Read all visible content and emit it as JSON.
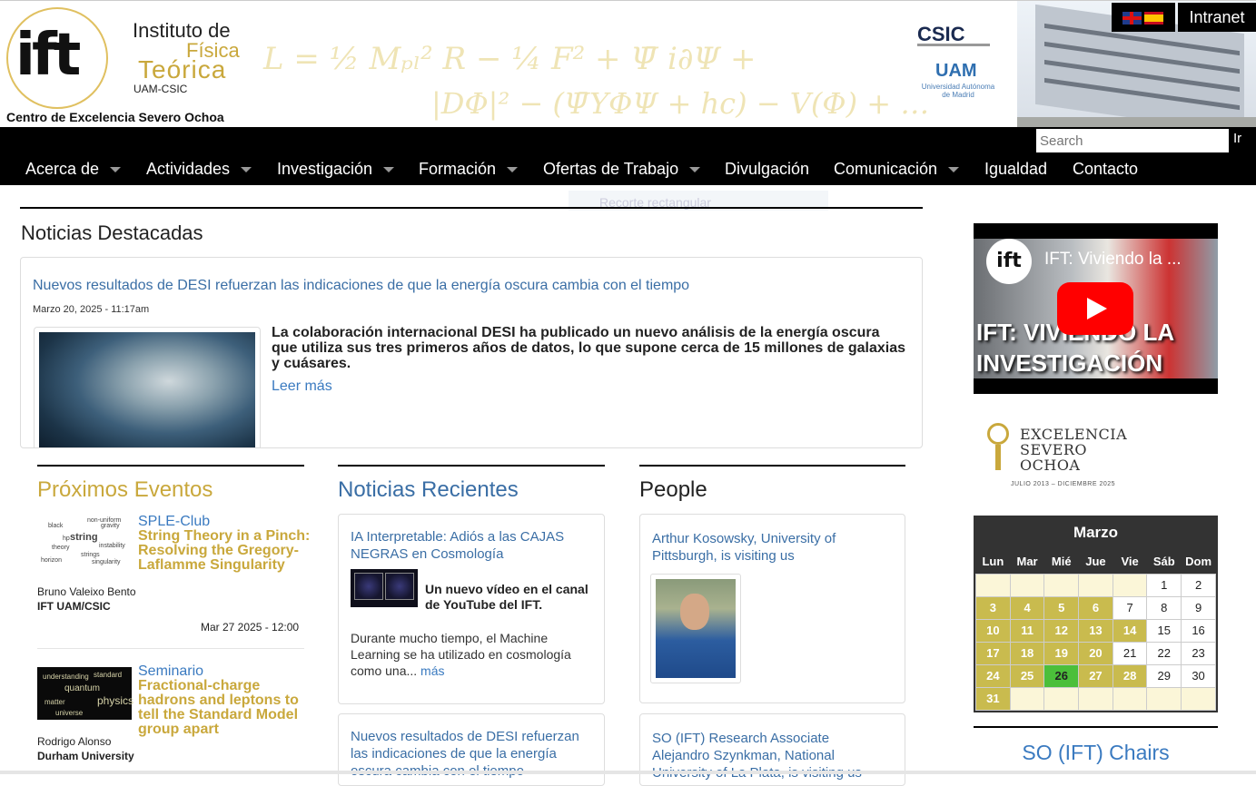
{
  "header": {
    "institute_line1": "Instituto de",
    "institute_line2": "Física",
    "institute_line3": "Teórica",
    "institute_line4": "UAM-CSIC",
    "logo_text": "ift",
    "severo_ochoa": "Centro de Excelencia Severo Ochoa",
    "formula_line1": "L = ½ Mₚₗ² R − ¼ F² + Ψ̄ i∂Ψ +",
    "formula_line2": "|DΦ|² − (Ψ̄YΦΨ + hc) − V(Φ) + …",
    "csic": "CSIC",
    "uam": "UAM",
    "uam_sub": "Universidad Autónoma de Madrid",
    "intranet": "Intranet"
  },
  "nav": {
    "search_placeholder": "Search",
    "search_button": "Ir",
    "items": [
      {
        "label": "Acerca de",
        "dropdown": true
      },
      {
        "label": "Actividades",
        "dropdown": true
      },
      {
        "label": "Investigación",
        "dropdown": true
      },
      {
        "label": "Formación",
        "dropdown": true
      },
      {
        "label": "Ofertas de Trabajo",
        "dropdown": true
      },
      {
        "label": "Divulgación",
        "dropdown": false
      },
      {
        "label": "Comunicación",
        "dropdown": true
      },
      {
        "label": "Igualdad",
        "dropdown": false
      },
      {
        "label": "Contacto",
        "dropdown": false
      }
    ],
    "tooltip": "Recorte rectangular"
  },
  "featured": {
    "heading": "Noticias Destacadas",
    "title": "Nuevos resultados de DESI refuerzan las indicaciones de que la energía oscura cambia con el tiempo",
    "date": "Marzo 20, 2025 - 11:17am",
    "summary": "La colaboración internacional DESI ha publicado un nuevo análisis de la energía oscura que utiliza sus tres primeros años de datos, lo que supone cerca de 15 millones de galaxias y cuásares.",
    "read_more": "Leer más"
  },
  "events": {
    "heading": "Próximos Eventos",
    "items": [
      {
        "type": "SPLE-Club",
        "title": "String Theory in a Pinch: Resolving the Gregory-Laflamme Singularity",
        "speaker": "Bruno Valeixo Bento",
        "institution": "IFT UAM/CSIC",
        "date": "Mar 27 2025 - 12:00"
      },
      {
        "type": "Seminario",
        "title": "Fractional-charge hadrons and leptons to tell the Standard Model group apart",
        "speaker": "Rodrigo Alonso",
        "institution": "Durham University",
        "date": ""
      }
    ],
    "wordcloud1": [
      "black",
      "string",
      "theory",
      "strings",
      "hp",
      "gravity",
      "non-uniform",
      "instability",
      "horizon",
      "singularity"
    ],
    "wordcloud2": [
      "understanding",
      "quantum",
      "physics",
      "matter",
      "universe",
      "standard"
    ]
  },
  "recent_news": {
    "heading": "Noticias Recientes",
    "items": [
      {
        "title": "IA Interpretable: Adiós a las CAJAS NEGRAS en Cosmología",
        "lead": "Un nuevo vídeo en el canal de YouTube del IFT.",
        "body": "Durante mucho tiempo, el Machine Learning se ha utilizado en cosmología como una...",
        "more": "más"
      },
      {
        "title": "Nuevos resultados de DESI refuerzan las indicaciones de que la energía oscura cambia con el tiempo"
      }
    ]
  },
  "people": {
    "heading": "People",
    "items": [
      {
        "title": "Arthur Kosowsky, University of Pittsburgh, is visiting us"
      },
      {
        "title": "SO (IFT) Research Associate Alejandro Szynkman, National University of La Plata, is visiting us"
      }
    ]
  },
  "sidebar": {
    "video_title": "IFT: Viviendo la ...",
    "video_overlay": "IFT: VIVIENDO LA INVESTIGACIÓN",
    "so_logo_line1": "EXCELENCIA",
    "so_logo_line2": "SEVERO",
    "so_logo_line3": "OCHOA",
    "so_logo_dates": "JULIO 2013 – DICIEMBRE 2025",
    "calendar": {
      "month": "Marzo",
      "weekdays": [
        "Lun",
        "Mar",
        "Mié",
        "Jue",
        "Vie",
        "Sáb",
        "Dom"
      ],
      "weeks": [
        [
          "",
          "",
          "",
          "",
          "",
          "1",
          "2"
        ],
        [
          "3",
          "4",
          "5",
          "6",
          "7",
          "8",
          "9"
        ],
        [
          "10",
          "11",
          "12",
          "13",
          "14",
          "15",
          "16"
        ],
        [
          "17",
          "18",
          "19",
          "20",
          "21",
          "22",
          "23"
        ],
        [
          "24",
          "25",
          "26",
          "27",
          "28",
          "29",
          "30"
        ],
        [
          "31",
          "",
          "",
          "",
          "",
          "",
          ""
        ]
      ],
      "highlighted_days": [
        "3",
        "4",
        "5",
        "6",
        "10",
        "11",
        "12",
        "13",
        "14",
        "17",
        "18",
        "19",
        "20",
        "24",
        "25",
        "27",
        "28",
        "31"
      ],
      "today": "26"
    },
    "chairs_heading": "SO (IFT) Chairs"
  },
  "colors": {
    "gold": "#c9a83c",
    "link_blue": "#3a6ea5",
    "nav_bg": "#000000",
    "calendar_highlight": "#c9bb4e",
    "calendar_today": "#4bbf3a"
  }
}
